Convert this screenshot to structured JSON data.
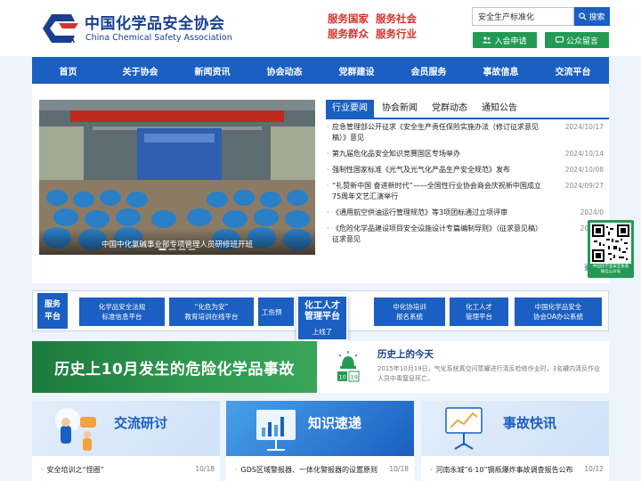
{
  "header": {
    "logo_cn": "中国化学品安全协会",
    "logo_en": "China Chemical Safety Association",
    "slogans": [
      "服务国家",
      "服务社会",
      "服务群众",
      "服务行业"
    ],
    "search_value": "安全生产标准化",
    "search_label": "搜索",
    "join_label": "入会申请",
    "message_label": "公众留言"
  },
  "nav": [
    "首页",
    "关于协会",
    "新闻资讯",
    "协会动态",
    "党群建设",
    "会员服务",
    "事故信息",
    "交流平台"
  ],
  "carousel": {
    "caption": "中国中化氯碱事业部专项管理人员研修班开班"
  },
  "tabs": [
    "行业要闻",
    "协会新闻",
    "党群动态",
    "通知公告"
  ],
  "news": [
    {
      "title": "应急管理部公开征求《安全生产责任保险实施办法（修订征求意见稿）》意见",
      "date": "2024/10/17"
    },
    {
      "title": "第九届危化品安全知识竞赛国区专场举办",
      "date": "2024/10/14"
    },
    {
      "title": "强制性国家标准《光气及光气化产品生产安全规范》发布",
      "date": "2024/10/08"
    },
    {
      "title": "“礼赞新中国 奋进新时代”——全国性行业协会商会庆祝新中国成立75周年文艺汇演举行",
      "date": "2024/09/27"
    },
    {
      "title": "《通用航空供油运行管理规范》等3项团标通过立项评审",
      "date": "2024/0"
    },
    {
      "title": "《危险化学品建设项目安全设施设计专篇编制导则》（征求意见稿）征求意见",
      "date": "2024/0"
    }
  ],
  "more_label": "更",
  "qr": {
    "caption": "中国化学品安全协会\n微信公众号"
  },
  "service": {
    "label": "服务\n平台",
    "buttons": [
      "化学品安全法规\n标准信息平台",
      "“化危为安”\n教育培训在线平台",
      "工伤预",
      "中化协培训\n报名系统",
      "化工人才\n管理平台",
      "中国化学品安全\n协会OA办公系统"
    ],
    "talent_title": "化工人才\n管理平台",
    "talent_sub": "上线了"
  },
  "history": {
    "banner": "历史上10月发生的危险化学品事故",
    "title": "历史上的今天",
    "date_day": "10",
    "date_num": "19",
    "text": "2015年10月19日，气化系统真空闪蒸罐进行清反检修作业时，3名罐内清反作业人员中毒窒息死亡。"
  },
  "cards": [
    {
      "title": "交流研讨",
      "item": "安全培训之“怪圈”",
      "date": "10/18"
    },
    {
      "title": "知识速递",
      "item": "GDS区域警报器、一体化警报器的设置原则",
      "date": "10/18"
    },
    {
      "title": "事故快讯",
      "item": "河南永城“6·10”钢瓶爆炸事故调查报告公布",
      "date": "10/12"
    }
  ],
  "colors": {
    "primary_blue": "#1a5fc1",
    "accent_red": "#d0342c",
    "accent_green": "#239a54",
    "background": "#eef4fb"
  }
}
